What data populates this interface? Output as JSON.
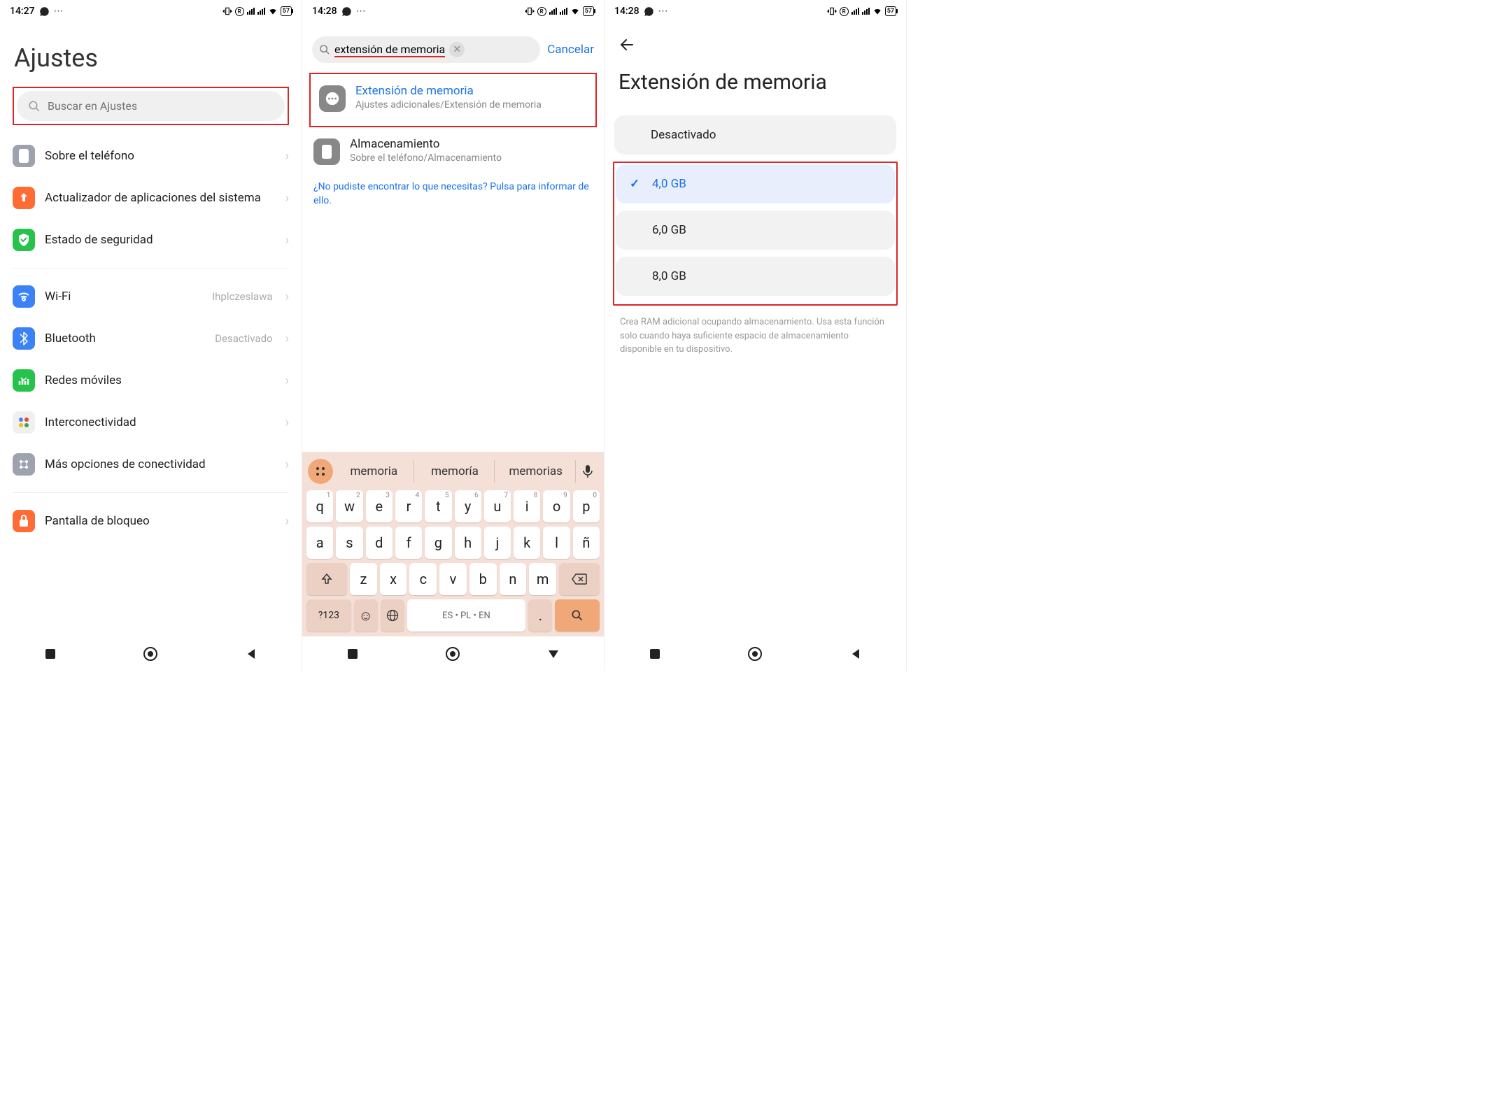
{
  "screen1": {
    "status": {
      "time": "14:27",
      "battery": "57"
    },
    "title": "Ajustes",
    "search_placeholder": "Buscar en Ajustes",
    "items": [
      {
        "label": "Sobre el teléfono",
        "icon_bg": "#9da2ae",
        "value": ""
      },
      {
        "label": "Actualizador de aplicaciones del sistema",
        "icon_bg": "#ff6b35",
        "value": ""
      },
      {
        "label": "Estado de seguridad",
        "icon_bg": "#27c24c",
        "value": ""
      }
    ],
    "items2": [
      {
        "label": "Wi-Fi",
        "icon_bg": "#3b82f6",
        "value": "Ihplczeslawa"
      },
      {
        "label": "Bluetooth",
        "icon_bg": "#3b82f6",
        "value": "Desactivado"
      },
      {
        "label": "Redes móviles",
        "icon_bg": "#27c24c",
        "value": ""
      },
      {
        "label": "Interconectividad",
        "icon_bg": "#f0f0f0",
        "value": ""
      },
      {
        "label": "Más opciones de conectividad",
        "icon_bg": "#9da2ae",
        "value": ""
      }
    ],
    "items3": [
      {
        "label": "Pantalla de bloqueo",
        "icon_bg": "#ff6b35",
        "value": ""
      }
    ]
  },
  "screen2": {
    "status": {
      "time": "14:28",
      "battery": "57"
    },
    "search_value": "extensión de memoria",
    "cancel": "Cancelar",
    "result1": {
      "title": "Extensión de memoria",
      "sub": "Ajustes adicionales/Extensión de memoria"
    },
    "result2": {
      "title": "Almacenamiento",
      "sub": "Sobre el teléfono/Almacenamiento"
    },
    "feedback": "¿No pudiste encontrar lo que necesitas? Pulsa para informar de ello.",
    "keyboard": {
      "suggestions": [
        "memoria",
        "memoría",
        "memorias"
      ],
      "row1": [
        [
          "q",
          "1"
        ],
        [
          "w",
          "2"
        ],
        [
          "e",
          "3"
        ],
        [
          "r",
          "4"
        ],
        [
          "t",
          "5"
        ],
        [
          "y",
          "6"
        ],
        [
          "u",
          "7"
        ],
        [
          "i",
          "8"
        ],
        [
          "o",
          "9"
        ],
        [
          "p",
          "0"
        ]
      ],
      "row2": [
        "a",
        "s",
        "d",
        "f",
        "g",
        "h",
        "j",
        "k",
        "l",
        "ñ"
      ],
      "row3": [
        "z",
        "x",
        "c",
        "v",
        "b",
        "n",
        "m"
      ],
      "space_label": "ES • PL • EN",
      "numkey": "?123"
    }
  },
  "screen3": {
    "status": {
      "time": "14:28",
      "battery": "57"
    },
    "title": "Extensión de memoria",
    "options": [
      {
        "label": "Desactivado",
        "selected": false
      },
      {
        "label": "4,0 GB",
        "selected": true
      },
      {
        "label": "6,0 GB",
        "selected": false
      },
      {
        "label": "8,0 GB",
        "selected": false
      }
    ],
    "help": "Crea RAM adicional ocupando almacenamiento. Usa esta función solo cuando haya suficiente espacio de almacenamiento disponible en tu dispositivo."
  }
}
